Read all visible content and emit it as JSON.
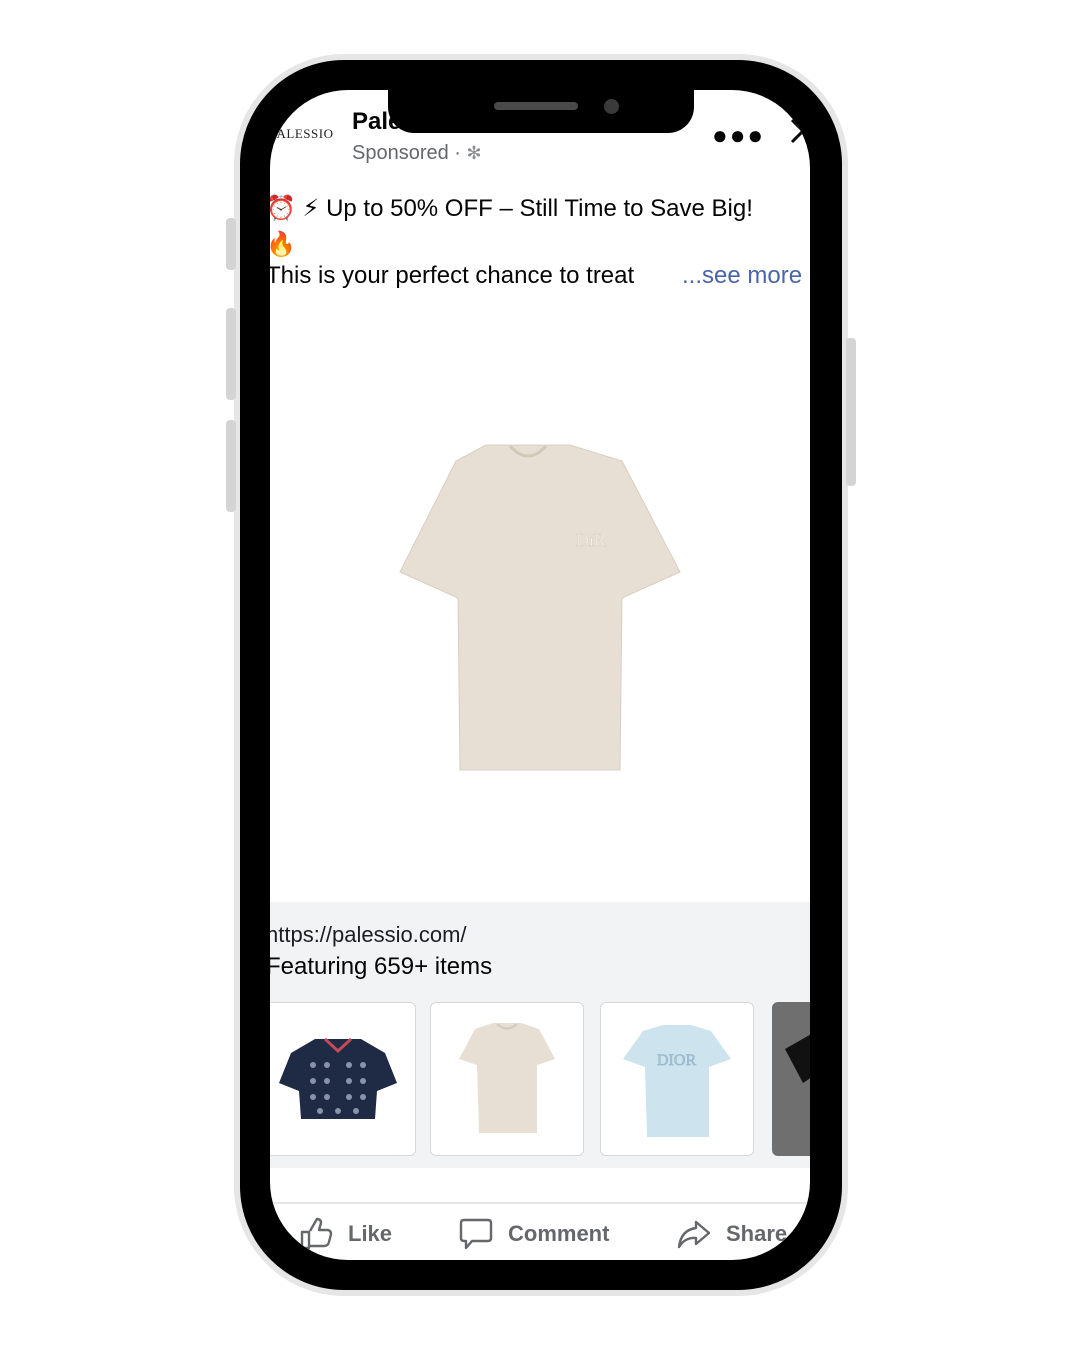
{
  "post": {
    "logo_text": "PALESSIO",
    "page_name": "Palessio",
    "sponsored": "Sponsored · ",
    "caption_line1": "⏰ ⚡ Up to 50% OFF – Still Time to Save Big!",
    "caption_line1_emoji": "🔥",
    "caption_line2": "This is your perfect chance to treat",
    "see_more": "...see more"
  },
  "link": {
    "url": "https://palessio.com/",
    "featuring": "Featuring 659+ items"
  },
  "carousel": {
    "items": [
      {
        "name": "navy patterned polo shirt"
      },
      {
        "name": "beige logo t-shirt"
      },
      {
        "name": "light blue logo t-shirt"
      },
      {
        "name": "black item partially visible"
      }
    ]
  },
  "actions": {
    "like": "Like",
    "comment": "Comment",
    "share": "Share"
  },
  "colors": {
    "link_blue": "#4b64a8",
    "muted_gray": "#65676b",
    "shirt_beige": "#e7dfd3",
    "shirt_blue": "#cde3ee",
    "polo_navy": "#1f2a44"
  }
}
